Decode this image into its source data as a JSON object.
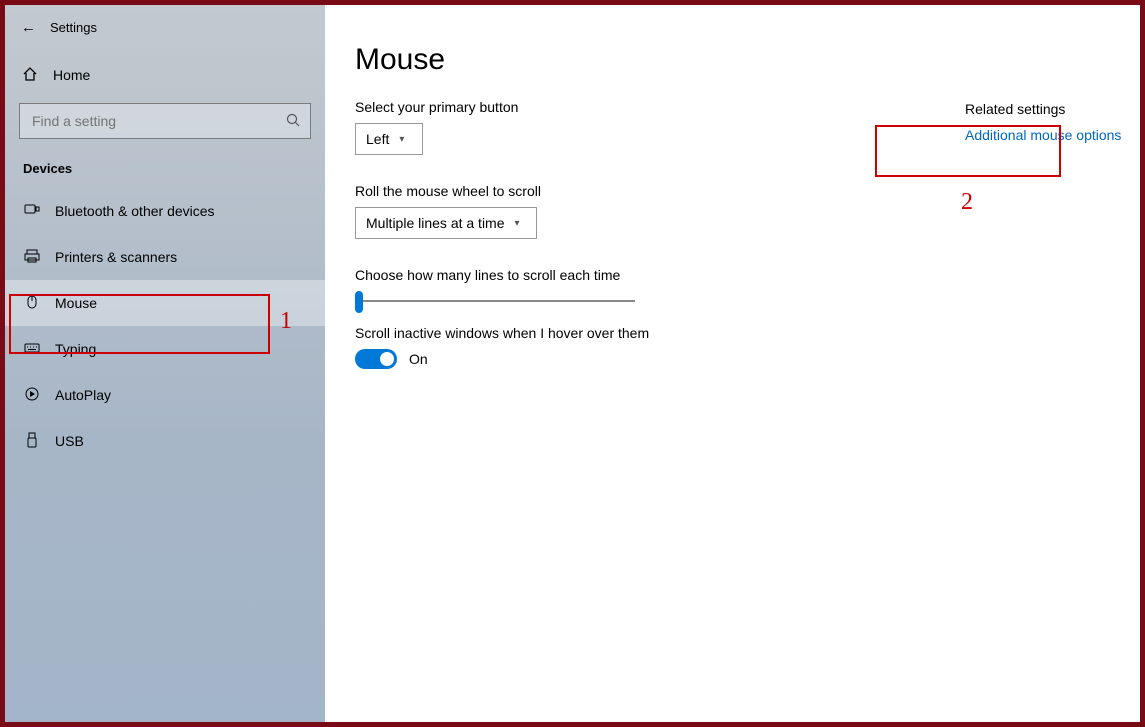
{
  "window": {
    "title": "Settings"
  },
  "sidebar": {
    "home_label": "Home",
    "search_placeholder": "Find a setting",
    "section_label": "Devices",
    "items": [
      {
        "icon": "bt",
        "label": "Bluetooth & other devices"
      },
      {
        "icon": "printer",
        "label": "Printers & scanners"
      },
      {
        "icon": "mouse",
        "label": "Mouse",
        "selected": true
      },
      {
        "icon": "keyboard",
        "label": "Typing"
      },
      {
        "icon": "autoplay",
        "label": "AutoPlay"
      },
      {
        "icon": "usb",
        "label": "USB"
      }
    ]
  },
  "main": {
    "title": "Mouse",
    "primary_button_label": "Select your primary button",
    "primary_button_value": "Left",
    "wheel_label": "Roll the mouse wheel to scroll",
    "wheel_value": "Multiple lines at a time",
    "lines_label": "Choose how many lines to scroll each time",
    "inactive_label": "Scroll inactive windows when I hover over them",
    "toggle_state_label": "On"
  },
  "related": {
    "title": "Related settings",
    "link": "Additional mouse options"
  },
  "annotations": {
    "one": "1",
    "two": "2"
  }
}
